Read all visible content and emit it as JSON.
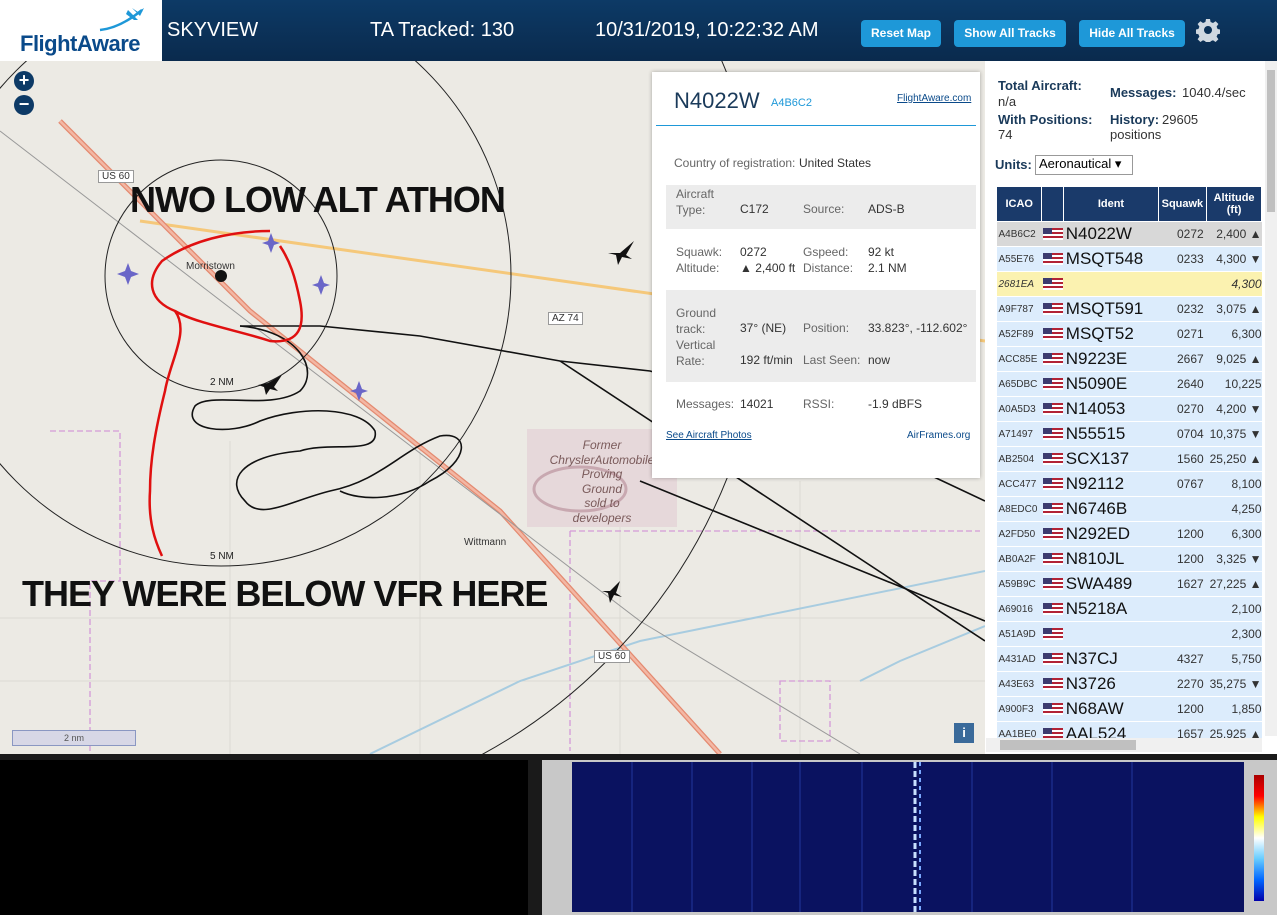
{
  "topbar": {
    "logo_text": "FlightAware",
    "app_name": "SKYVIEW",
    "tracked": "TA Tracked: 130",
    "datetime": "10/31/2019, 10:22:32 AM",
    "btn_reset": "Reset Map",
    "btn_show": "Show All Tracks",
    "btn_hide": "Hide All Tracks",
    "settings_icon": "gear-icon"
  },
  "map": {
    "annotation_top": "NWO LOW ALT ATHON",
    "annotation_bottom": "THEY WERE BELOW VFR HERE",
    "label_town1": "Morristown",
    "label_town2": "Wittmann",
    "label_us60_a": "US 60",
    "label_us60_b": "US 60",
    "label_az74": "AZ 74",
    "label_2nm": "2 NM",
    "label_5nm": "5 NM",
    "proving_ground": [
      "Former",
      "ChryslerAutomobile",
      "Proving",
      "Ground",
      "sold to",
      "developers"
    ],
    "scale_label": "2 nm",
    "zoom_in": "+",
    "zoom_out": "−",
    "info": "i"
  },
  "popup": {
    "registration": "N4022W",
    "hex": "A4B6C2",
    "fa_link": "FlightAware.com",
    "country_label": "Country of registration:",
    "country_value": "United States",
    "aircraft_type_label": "Aircraft Type:",
    "aircraft_type": "C172",
    "source_label": "Source:",
    "source": "ADS-B",
    "squawk_label": "Squawk:",
    "squawk": "0272",
    "gspeed_label": "Gspeed:",
    "gspeed": "92 kt",
    "altitude_label": "Altitude:",
    "altitude": "▲ 2,400 ft",
    "distance_label": "Distance:",
    "distance": "2.1 NM",
    "ground_track_label": "Ground track:",
    "ground_track": "37° (NE)",
    "position_label": "Position:",
    "position": "33.823°, -112.602°",
    "vrate_label": "Vertical Rate:",
    "vrate": "192 ft/min",
    "last_seen_label": "Last Seen:",
    "last_seen": "now",
    "messages_label": "Messages:",
    "messages": "14021",
    "rssi_label": "RSSI:",
    "rssi": "-1.9 dBFS",
    "photos_link": "See Aircraft Photos",
    "airframes_link": "AirFrames.org"
  },
  "sidebar": {
    "total_label": "Total Aircraft:",
    "total_value": "n/a",
    "messages_label": "Messages:",
    "messages_value": "1040.4/sec",
    "with_pos_label": "With Positions:",
    "with_pos_value": "74",
    "history_label": "History:",
    "history_value": "29605 positions",
    "units_label": "Units:",
    "units_value": "Aeronautical ▾",
    "columns": [
      "ICAO",
      "",
      "Ident",
      "Squawk",
      "Altitude (ft)"
    ],
    "rows": [
      {
        "icao": "A4B6C2",
        "ident": "N4022W",
        "squawk": "0272",
        "alt": "2,400 ▲",
        "style": "sel"
      },
      {
        "icao": "A55E76",
        "ident": "MSQT548",
        "squawk": "0233",
        "alt": "4,300 ▼",
        "style": "row"
      },
      {
        "icao": "2681EA",
        "ident": "",
        "squawk": "",
        "alt": "4,300",
        "style": "yel"
      },
      {
        "icao": "A9F787",
        "ident": "MSQT591",
        "squawk": "0232",
        "alt": "3,075 ▲",
        "style": "row"
      },
      {
        "icao": "A52F89",
        "ident": "MSQT52",
        "squawk": "0271",
        "alt": "6,300",
        "style": "row"
      },
      {
        "icao": "ACC85E",
        "ident": "N9223E",
        "squawk": "2667",
        "alt": "9,025 ▲",
        "style": "row"
      },
      {
        "icao": "A65DBC",
        "ident": "N5090E",
        "squawk": "2640",
        "alt": "10,225",
        "style": "row"
      },
      {
        "icao": "A0A5D3",
        "ident": "N14053",
        "squawk": "0270",
        "alt": "4,200 ▼",
        "style": "row"
      },
      {
        "icao": "A71497",
        "ident": "N55515",
        "squawk": "0704",
        "alt": "10,375 ▼",
        "style": "row"
      },
      {
        "icao": "AB2504",
        "ident": "SCX137",
        "squawk": "1560",
        "alt": "25,250 ▲",
        "style": "row"
      },
      {
        "icao": "ACC477",
        "ident": "N92112",
        "squawk": "0767",
        "alt": "8,100",
        "style": "row"
      },
      {
        "icao": "A8EDC0",
        "ident": "N6746B",
        "squawk": "",
        "alt": "4,250",
        "style": "row"
      },
      {
        "icao": "A2FD50",
        "ident": "N292ED",
        "squawk": "1200",
        "alt": "6,300",
        "style": "row"
      },
      {
        "icao": "AB0A2F",
        "ident": "N810JL",
        "squawk": "1200",
        "alt": "3,325 ▼",
        "style": "row"
      },
      {
        "icao": "A59B9C",
        "ident": "SWA489",
        "squawk": "1627",
        "alt": "27,225 ▲",
        "style": "row"
      },
      {
        "icao": "A69016",
        "ident": "N5218A",
        "squawk": "",
        "alt": "2,100",
        "style": "row"
      },
      {
        "icao": "A51A9D",
        "ident": "",
        "squawk": "",
        "alt": "2,300",
        "style": "row"
      },
      {
        "icao": "A431AD",
        "ident": "N37CJ",
        "squawk": "4327",
        "alt": "5,750",
        "style": "row"
      },
      {
        "icao": "A43E63",
        "ident": "N3726",
        "squawk": "2270",
        "alt": "35,275 ▼",
        "style": "row"
      },
      {
        "icao": "A900F3",
        "ident": "N68AW",
        "squawk": "1200",
        "alt": "1,850",
        "style": "row"
      },
      {
        "icao": "AA1BE0",
        "ident": "AAL524",
        "squawk": "1657",
        "alt": "25,925 ▲",
        "style": "row"
      }
    ]
  },
  "colors": {
    "topbar": "#0d3a66",
    "button": "#1e98d8",
    "annotation_red": "#e01010"
  }
}
